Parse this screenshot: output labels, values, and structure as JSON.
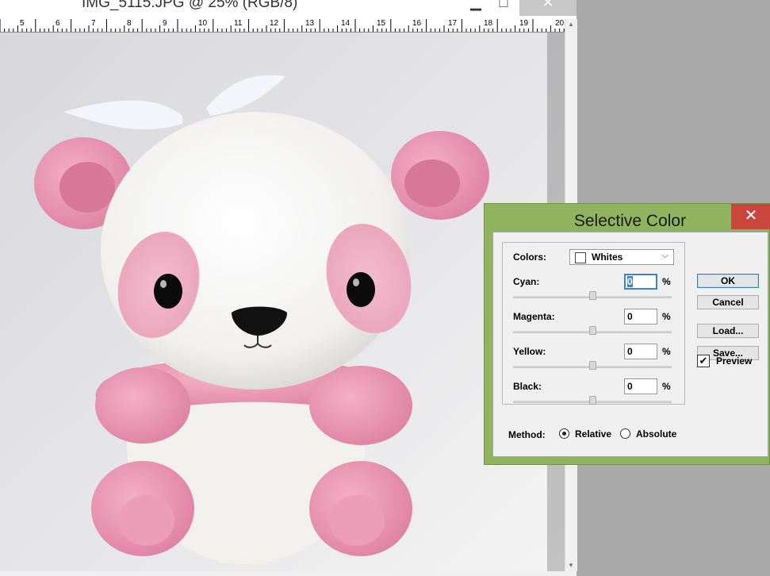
{
  "document": {
    "title": "IMG_5115.JPG @ 25% (RGB/8)",
    "window_buttons": {
      "minimize": "▁",
      "maximize": "□",
      "close": "✕"
    },
    "ruler_numbers": [
      "5",
      "6",
      "7",
      "8",
      "9",
      "10",
      "11",
      "12",
      "13",
      "14",
      "15",
      "16",
      "17",
      "18",
      "19",
      "20"
    ]
  },
  "dialog": {
    "title": "Selective Color",
    "close": "✕",
    "colors_label": "Colors:",
    "colors_value": "Whites",
    "sliders": [
      {
        "label": "Cyan:",
        "value": "0",
        "unit": "%",
        "level": 0
      },
      {
        "label": "Magenta:",
        "value": "0",
        "unit": "%",
        "level": 0
      },
      {
        "label": "Yellow:",
        "value": "0",
        "unit": "%",
        "level": 0
      },
      {
        "label": "Black:",
        "value": "0",
        "unit": "%",
        "level": 0
      }
    ],
    "buttons": {
      "ok": "OK",
      "cancel": "Cancel",
      "load": "Load...",
      "save": "Save..."
    },
    "preview_label": "Preview",
    "preview_checked": true,
    "method_label": "Method:",
    "method_options": [
      "Relative",
      "Absolute"
    ],
    "method_selected": "Relative"
  }
}
